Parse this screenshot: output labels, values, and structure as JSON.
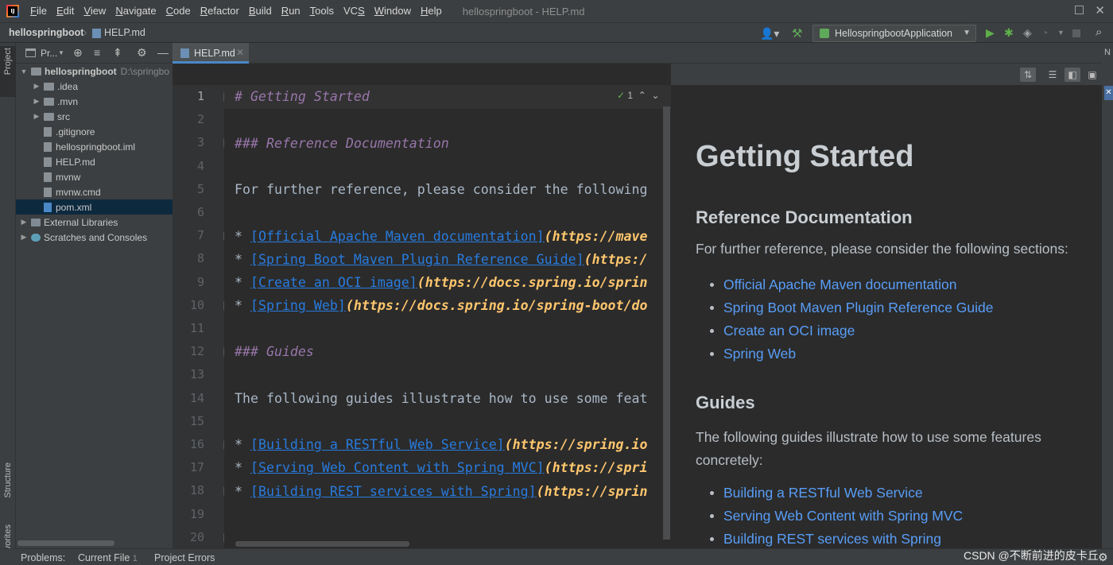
{
  "menubar": {
    "items": [
      {
        "label": "File",
        "u": "F",
        "rest": "ile"
      },
      {
        "label": "Edit",
        "u": "E",
        "rest": "dit"
      },
      {
        "label": "View",
        "u": "V",
        "rest": "iew"
      },
      {
        "label": "Navigate",
        "u": "N",
        "rest": "avigate"
      },
      {
        "label": "Code",
        "u": "C",
        "rest": "ode"
      },
      {
        "label": "Refactor",
        "u": "R",
        "rest": "efactor"
      },
      {
        "label": "Build",
        "u": "B",
        "rest": "uild"
      },
      {
        "label": "Run",
        "u": "R",
        "rest": "un"
      },
      {
        "label": "Tools",
        "u": "T",
        "rest": "ools"
      },
      {
        "label": "VCS",
        "u": "S",
        "rest": "",
        "pre": "VC"
      },
      {
        "label": "Window",
        "u": "W",
        "rest": "indow"
      },
      {
        "label": "Help",
        "u": "H",
        "rest": "elp"
      }
    ],
    "window_title": "hellospringboot - HELP.md"
  },
  "navbar": {
    "project": "hellospringboot",
    "file": "HELP.md",
    "run_config": "HellospringbootApplication"
  },
  "project_panel": {
    "title": "Pr...",
    "root": {
      "name": "hellospringboot",
      "path": "D:\\springbo"
    },
    "items": [
      {
        "name": ".idea",
        "kind": "folder",
        "expandable": true
      },
      {
        "name": ".mvn",
        "kind": "folder",
        "expandable": true
      },
      {
        "name": "src",
        "kind": "folder",
        "expandable": true
      },
      {
        "name": ".gitignore",
        "kind": "file"
      },
      {
        "name": "hellospringboot.iml",
        "kind": "file"
      },
      {
        "name": "HELP.md",
        "kind": "file"
      },
      {
        "name": "mvnw",
        "kind": "file"
      },
      {
        "name": "mvnw.cmd",
        "kind": "file"
      },
      {
        "name": "pom.xml",
        "kind": "file",
        "selected": true
      }
    ],
    "external": "External Libraries",
    "scratches": "Scratches and Consoles"
  },
  "tool_strip": {
    "project": "Project",
    "structure": "Structure",
    "favorites": "Favorites"
  },
  "editor": {
    "tab_label": "HELP.md",
    "inspection_count": "1",
    "line_numbers": [
      "1",
      "2",
      "3",
      "4",
      "5",
      "6",
      "7",
      "8",
      "9",
      "10",
      "11",
      "12",
      "13",
      "14",
      "15",
      "16",
      "17",
      "18",
      "19",
      "20"
    ],
    "lines": {
      "l1": "# Getting Started",
      "l3": "### Reference Documentation",
      "l5": "For further reference, please consider the following",
      "l7_text": "[Official Apache Maven documentation]",
      "l7_url": "(https://mave",
      "l8_text": "[Spring Boot Maven Plugin Reference Guide]",
      "l8_url": "(https:/",
      "l9_text": "[Create an OCI image]",
      "l9_url": "(https://docs.spring.io/sprin",
      "l10_text": "[Spring Web]",
      "l10_url": "(https://docs.spring.io/spring-boot/do",
      "l12": "### Guides",
      "l14": "The following guides illustrate how to use some feat",
      "l16_text": "[Building a RESTful Web Service]",
      "l16_url": "(https://spring.io",
      "l17_text": "[Serving Web Content with Spring MVC]",
      "l17_url": "(https://spri",
      "l18_text": "[Building REST services with Spring]",
      "l18_url": "(https://sprin"
    },
    "bullet": "* "
  },
  "preview": {
    "h1": "Getting Started",
    "h3a": "Reference Documentation",
    "p1": "For further reference, please consider the following sections:",
    "links_a": [
      "Official Apache Maven documentation",
      "Spring Boot Maven Plugin Reference Guide",
      "Create an OCI image",
      "Spring Web"
    ],
    "h3b": "Guides",
    "p2": "The following guides illustrate how to use some features concretely:",
    "links_b": [
      "Building a RESTful Web Service",
      "Serving Web Content with Spring MVC",
      "Building REST services with Spring"
    ]
  },
  "statusbar": {
    "problems": "Problems:",
    "current_file": "Current File",
    "current_file_count": "1",
    "project_errors": "Project Errors",
    "watermark": "CSDN @不断前进的皮卡丘"
  },
  "colors": {
    "accent": "#4a88c7",
    "link": "#589df6",
    "heading": "#9876aa",
    "url": "#ffc66d"
  }
}
